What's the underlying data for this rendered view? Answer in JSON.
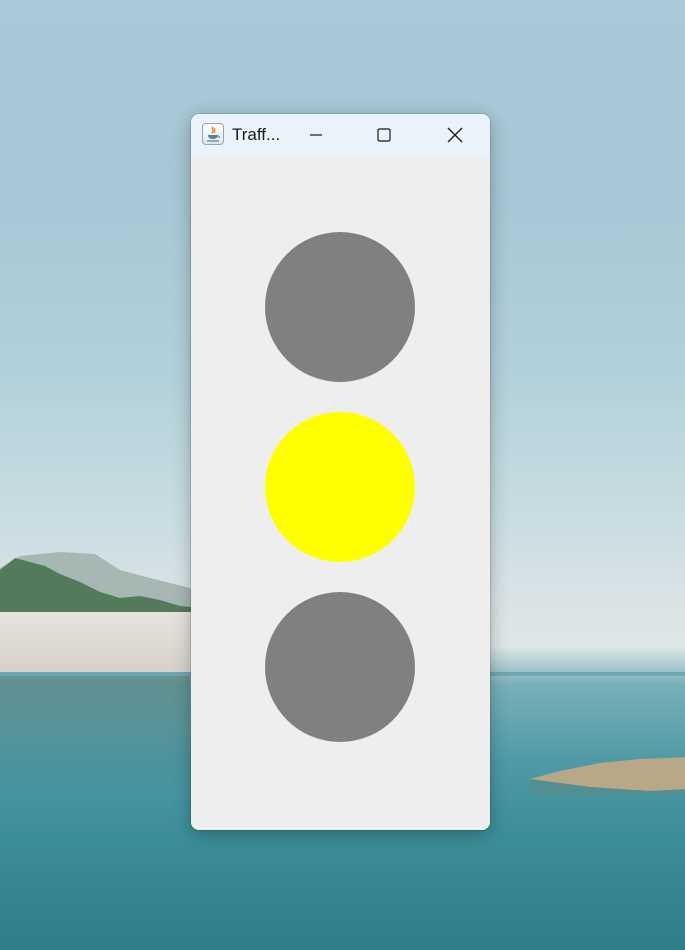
{
  "window": {
    "title": "Traff...",
    "app_icon": "java-icon",
    "controls": {
      "minimize_icon": "minimize-icon",
      "maximize_icon": "maximize-icon",
      "close_icon": "close-icon"
    }
  },
  "traffic_light": {
    "lamps": [
      {
        "position": "top",
        "state": "off",
        "color": "#808080"
      },
      {
        "position": "middle",
        "state": "on",
        "color": "#ffff00"
      },
      {
        "position": "bottom",
        "state": "off",
        "color": "#808080"
      }
    ],
    "background": "#eeeeee"
  },
  "desktop": {
    "wallpaper": "lake-landscape"
  }
}
